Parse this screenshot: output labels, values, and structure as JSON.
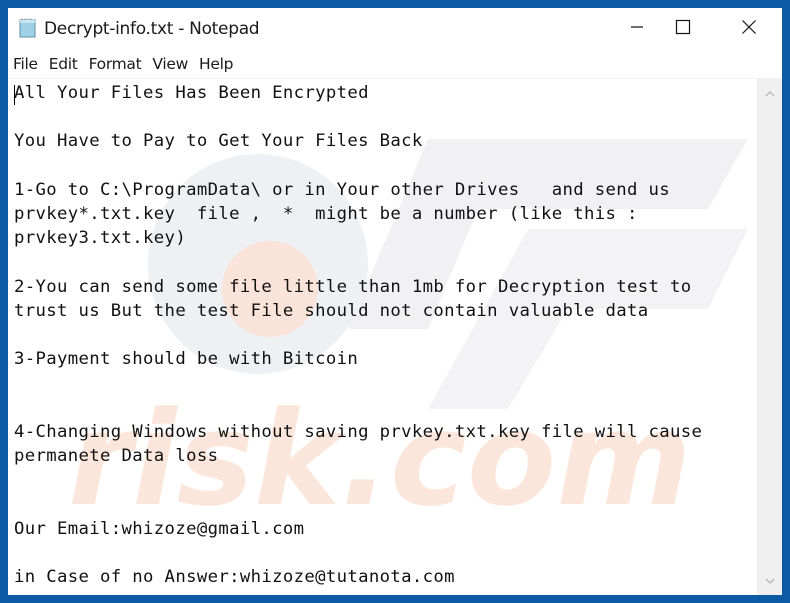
{
  "window": {
    "title": "Decrypt-info.txt - Notepad",
    "app_icon": "notepad-icon",
    "controls": {
      "minimize": "minimize-icon",
      "maximize": "maximize-icon",
      "close": "close-icon"
    }
  },
  "menu": {
    "items": [
      {
        "label": "File"
      },
      {
        "label": "Edit"
      },
      {
        "label": "Format"
      },
      {
        "label": "View"
      },
      {
        "label": "Help"
      }
    ]
  },
  "editor": {
    "content": "All Your Files Has Been Encrypted\n\nYou Have to Pay to Get Your Files Back\n\n1-Go to C:\\ProgramData\\ or in Your other Drives   and send us\nprvkey*.txt.key  file ,  *  might be a number (like this :\nprvkey3.txt.key)\n\n2-You can send some file little than 1mb for Decryption test to\ntrust us But the test File should not contain valuable data\n\n3-Payment should be with Bitcoin\n\n\n4-Changing Windows without saving prvkey.txt.key file will cause\npermanete Data loss\n\n\nOur Email:whizoze@gmail.com\n\nin Case of no Answer:whizoze@tutanota.com"
  },
  "watermark": {
    "text": "risk.com"
  },
  "colors": {
    "desktop_border": "#0c5aa3",
    "scrollbar_track": "#f0f0f0",
    "watermark_orange": "#f7d7c8",
    "watermark_gray": "#ececf0"
  }
}
